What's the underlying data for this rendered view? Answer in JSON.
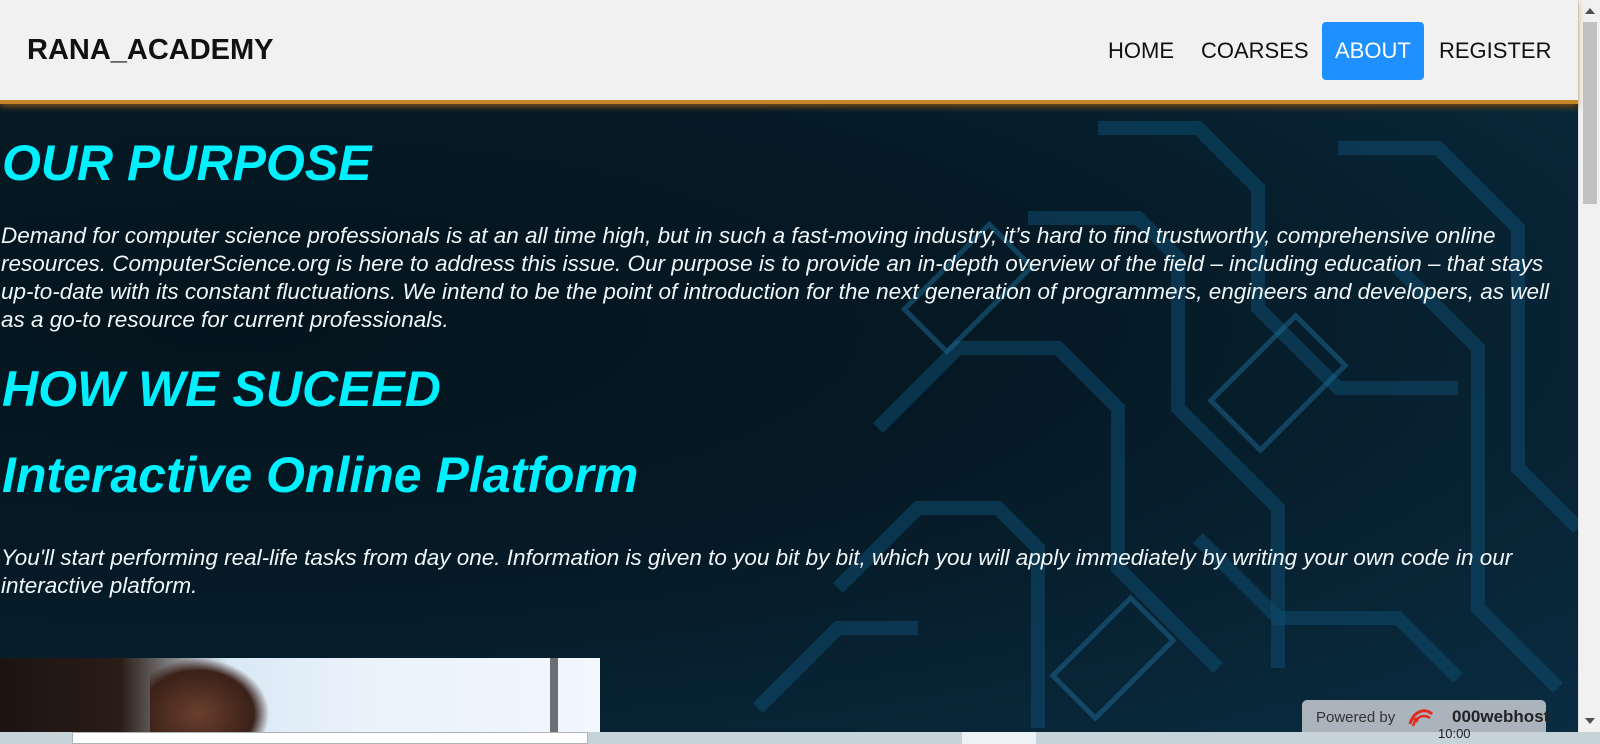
{
  "nav": {
    "brand": "RANA_ACADEMY",
    "items": [
      {
        "label": "HOME"
      },
      {
        "label": "COARSES"
      },
      {
        "label": "ABOUT"
      },
      {
        "label": "REGISTER"
      }
    ],
    "active_color": "#1e90ff"
  },
  "main": {
    "purpose_heading": "OUR PURPOSE",
    "purpose_text": "Demand for computer science professionals is at an all time high, but in such a fast-moving industry, it’s hard to find trustworthy, comprehensive online resources. ComputerScience.org is here to address this issue. Our purpose is to provide an in-depth overview of the field – including education – that stays up-to-date with its constant fluctuations. We intend to be the point of introduction for the next generation of programmers, engineers and developers, as well as a go-to resource for current professionals.",
    "succeed_heading": "HOW WE SUCEED",
    "platform_heading": "Interactive Online Platform",
    "platform_text": "You'll start performing real-life tasks from day one. Information is given to you bit by bit, which you will apply immediately by writing your own code in our interactive platform.",
    "heading_color": "#00f0ff"
  },
  "badge": {
    "powered_by": "Powered by",
    "brand": "000webhost"
  },
  "taskbar": {
    "clock": "10:00"
  }
}
